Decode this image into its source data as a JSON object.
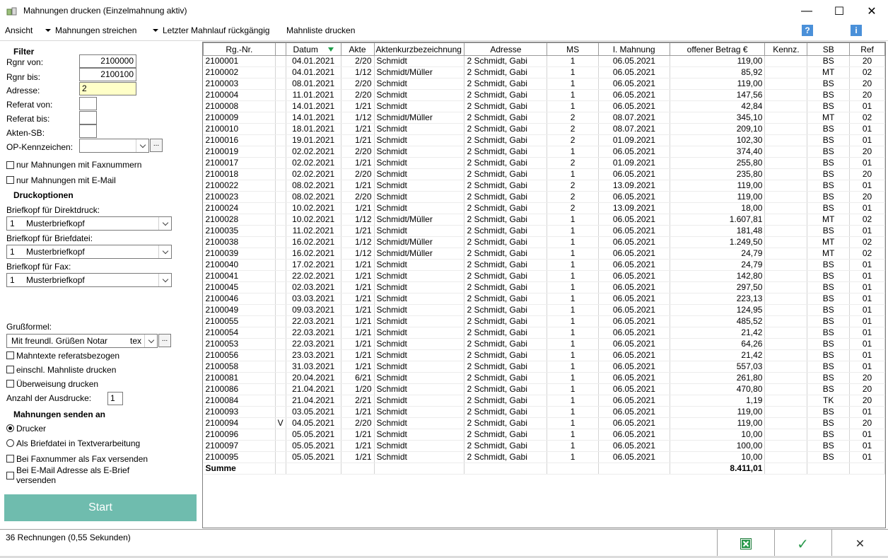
{
  "window": {
    "title": "Mahnungen drucken (Einzelmahnung aktiv)",
    "minimize": "—",
    "maximize": "☐",
    "close": "✕"
  },
  "menu": {
    "ansicht": "Ansicht",
    "streichen": "Mahnungen streichen",
    "rueckgaengig": "Letzter Mahnlauf rückgängig",
    "mahnliste": "Mahnliste drucken",
    "help1": "?",
    "help2": "i"
  },
  "filter": {
    "header": "Filter",
    "rgnr_von_label": "Rgnr von:",
    "rgnr_von_value": "2100000",
    "rgnr_bis_label": "Rgnr bis:",
    "rgnr_bis_value": "2100100",
    "adresse_label": "Adresse:",
    "adresse_value": "2",
    "referat_von_label": "Referat von:",
    "referat_bis_label": "Referat bis:",
    "akten_sb_label": "Akten-SB:",
    "op_kennzeichen_label": "OP-Kennzeichen:",
    "ellipsis": "...",
    "nur_fax": "nur Mahnungen mit Faxnummern",
    "nur_email": "nur Mahnungen mit E-Mail"
  },
  "druck": {
    "header": "Druckoptionen",
    "direktdruck_label": "Briefkopf für Direktdruck:",
    "direktdruck_nr": "1",
    "direktdruck_value": "Musterbriefkopf",
    "briefdatei_label": "Briefkopf für Briefdatei:",
    "briefdatei_nr": "1",
    "briefdatei_value": "Musterbriefkopf",
    "fax_label": "Briefkopf für Fax:",
    "fax_nr": "1",
    "fax_value": "Musterbriefkopf",
    "gruss_label": "Grußformel:",
    "gruss_value": "Mit freundl. Grüßen Notar",
    "gruss_suffix": "tex",
    "mahntexte": "Mahntexte referatsbezogen",
    "einschl": "einschl. Mahnliste drucken",
    "ueberweisung": "Überweisung drucken",
    "anzahl_label": "Anzahl der Ausdrucke:",
    "anzahl_value": "1"
  },
  "senden": {
    "header": "Mahnungen senden an",
    "drucker": "Drucker",
    "briefdatei": "Als Briefdatei in Textverarbeitung",
    "fax": "Bei Faxnummer als Fax versenden",
    "email": "Bei E-Mail Adresse als E-Brief versenden",
    "start": "Start"
  },
  "table": {
    "headers": [
      "Rg.-Nr.",
      "",
      "Datum",
      "Akte",
      "Aktenkurzbezeichnung",
      "Adresse",
      "MS",
      "l. Mahnung",
      "offener Betrag €",
      "Kennz.",
      "SB",
      "Ref"
    ],
    "rows": [
      [
        "2100001",
        "",
        "04.01.2021",
        "2/20",
        "Schmidt",
        "2 Schmidt, Gabi",
        "1",
        "06.05.2021",
        "119,00",
        "",
        "BS",
        "20"
      ],
      [
        "2100002",
        "",
        "04.01.2021",
        "1/12",
        "Schmidt/Müller",
        "2 Schmidt, Gabi",
        "1",
        "06.05.2021",
        "85,92",
        "",
        "MT",
        "02"
      ],
      [
        "2100003",
        "",
        "08.01.2021",
        "2/20",
        "Schmidt",
        "2 Schmidt, Gabi",
        "1",
        "06.05.2021",
        "119,00",
        "",
        "BS",
        "20"
      ],
      [
        "2100004",
        "",
        "11.01.2021",
        "2/20",
        "Schmidt",
        "2 Schmidt, Gabi",
        "1",
        "06.05.2021",
        "147,56",
        "",
        "BS",
        "20"
      ],
      [
        "2100008",
        "",
        "14.01.2021",
        "1/21",
        "Schmidt",
        "2 Schmidt, Gabi",
        "1",
        "06.05.2021",
        "42,84",
        "",
        "BS",
        "01"
      ],
      [
        "2100009",
        "",
        "14.01.2021",
        "1/12",
        "Schmidt/Müller",
        "2 Schmidt, Gabi",
        "2",
        "08.07.2021",
        "345,10",
        "",
        "MT",
        "02"
      ],
      [
        "2100010",
        "",
        "18.01.2021",
        "1/21",
        "Schmidt",
        "2 Schmidt, Gabi",
        "2",
        "08.07.2021",
        "209,10",
        "",
        "BS",
        "01"
      ],
      [
        "2100016",
        "",
        "19.01.2021",
        "1/21",
        "Schmidt",
        "2 Schmidt, Gabi",
        "2",
        "01.09.2021",
        "102,30",
        "",
        "BS",
        "01"
      ],
      [
        "2100019",
        "",
        "02.02.2021",
        "2/20",
        "Schmidt",
        "2 Schmidt, Gabi",
        "1",
        "06.05.2021",
        "374,40",
        "",
        "BS",
        "20"
      ],
      [
        "2100017",
        "",
        "02.02.2021",
        "1/21",
        "Schmidt",
        "2 Schmidt, Gabi",
        "2",
        "01.09.2021",
        "255,80",
        "",
        "BS",
        "01"
      ],
      [
        "2100018",
        "",
        "02.02.2021",
        "2/20",
        "Schmidt",
        "2 Schmidt, Gabi",
        "1",
        "06.05.2021",
        "235,80",
        "",
        "BS",
        "20"
      ],
      [
        "2100022",
        "",
        "08.02.2021",
        "1/21",
        "Schmidt",
        "2 Schmidt, Gabi",
        "2",
        "13.09.2021",
        "119,00",
        "",
        "BS",
        "01"
      ],
      [
        "2100023",
        "",
        "08.02.2021",
        "2/20",
        "Schmidt",
        "2 Schmidt, Gabi",
        "2",
        "06.05.2021",
        "119,00",
        "",
        "BS",
        "20"
      ],
      [
        "2100024",
        "",
        "10.02.2021",
        "1/21",
        "Schmidt",
        "2 Schmidt, Gabi",
        "2",
        "13.09.2021",
        "18,00",
        "",
        "BS",
        "01"
      ],
      [
        "2100028",
        "",
        "10.02.2021",
        "1/12",
        "Schmidt/Müller",
        "2 Schmidt, Gabi",
        "1",
        "06.05.2021",
        "1.607,81",
        "",
        "MT",
        "02"
      ],
      [
        "2100035",
        "",
        "11.02.2021",
        "1/21",
        "Schmidt",
        "2 Schmidt, Gabi",
        "1",
        "06.05.2021",
        "181,48",
        "",
        "BS",
        "01"
      ],
      [
        "2100038",
        "",
        "16.02.2021",
        "1/12",
        "Schmidt/Müller",
        "2 Schmidt, Gabi",
        "1",
        "06.05.2021",
        "1.249,50",
        "",
        "MT",
        "02"
      ],
      [
        "2100039",
        "",
        "16.02.2021",
        "1/12",
        "Schmidt/Müller",
        "2 Schmidt, Gabi",
        "1",
        "06.05.2021",
        "24,79",
        "",
        "MT",
        "02"
      ],
      [
        "2100040",
        "",
        "17.02.2021",
        "1/21",
        "Schmidt",
        "2 Schmidt, Gabi",
        "1",
        "06.05.2021",
        "24,79",
        "",
        "BS",
        "01"
      ],
      [
        "2100041",
        "",
        "22.02.2021",
        "1/21",
        "Schmidt",
        "2 Schmidt, Gabi",
        "1",
        "06.05.2021",
        "142,80",
        "",
        "BS",
        "01"
      ],
      [
        "2100045",
        "",
        "02.03.2021",
        "1/21",
        "Schmidt",
        "2 Schmidt, Gabi",
        "1",
        "06.05.2021",
        "297,50",
        "",
        "BS",
        "01"
      ],
      [
        "2100046",
        "",
        "03.03.2021",
        "1/21",
        "Schmidt",
        "2 Schmidt, Gabi",
        "1",
        "06.05.2021",
        "223,13",
        "",
        "BS",
        "01"
      ],
      [
        "2100049",
        "",
        "09.03.2021",
        "1/21",
        "Schmidt",
        "2 Schmidt, Gabi",
        "1",
        "06.05.2021",
        "124,95",
        "",
        "BS",
        "01"
      ],
      [
        "2100055",
        "",
        "22.03.2021",
        "1/21",
        "Schmidt",
        "2 Schmidt, Gabi",
        "1",
        "06.05.2021",
        "485,52",
        "",
        "BS",
        "01"
      ],
      [
        "2100054",
        "",
        "22.03.2021",
        "1/21",
        "Schmidt",
        "2 Schmidt, Gabi",
        "1",
        "06.05.2021",
        "21,42",
        "",
        "BS",
        "01"
      ],
      [
        "2100053",
        "",
        "22.03.2021",
        "1/21",
        "Schmidt",
        "2 Schmidt, Gabi",
        "1",
        "06.05.2021",
        "64,26",
        "",
        "BS",
        "01"
      ],
      [
        "2100056",
        "",
        "23.03.2021",
        "1/21",
        "Schmidt",
        "2 Schmidt, Gabi",
        "1",
        "06.05.2021",
        "21,42",
        "",
        "BS",
        "01"
      ],
      [
        "2100058",
        "",
        "31.03.2021",
        "1/21",
        "Schmidt",
        "2 Schmidt, Gabi",
        "1",
        "06.05.2021",
        "557,03",
        "",
        "BS",
        "01"
      ],
      [
        "2100081",
        "",
        "20.04.2021",
        "6/21",
        "Schmidt",
        "2 Schmidt, Gabi",
        "1",
        "06.05.2021",
        "261,80",
        "",
        "BS",
        "20"
      ],
      [
        "2100086",
        "",
        "21.04.2021",
        "1/20",
        "Schmidt",
        "2 Schmidt, Gabi",
        "1",
        "06.05.2021",
        "470,80",
        "",
        "BS",
        "20"
      ],
      [
        "2100084",
        "",
        "21.04.2021",
        "2/21",
        "Schmidt",
        "2 Schmidt, Gabi",
        "1",
        "06.05.2021",
        "1,19",
        "",
        "TK",
        "20"
      ],
      [
        "2100093",
        "",
        "03.05.2021",
        "1/21",
        "Schmidt",
        "2 Schmidt, Gabi",
        "1",
        "06.05.2021",
        "119,00",
        "",
        "BS",
        "01"
      ],
      [
        "2100094",
        "V",
        "04.05.2021",
        "2/20",
        "Schmidt",
        "2 Schmidt, Gabi",
        "1",
        "06.05.2021",
        "119,00",
        "",
        "BS",
        "20"
      ],
      [
        "2100096",
        "",
        "05.05.2021",
        "1/21",
        "Schmidt",
        "2 Schmidt, Gabi",
        "1",
        "06.05.2021",
        "10,00",
        "",
        "BS",
        "01"
      ],
      [
        "2100097",
        "",
        "05.05.2021",
        "1/21",
        "Schmidt",
        "2 Schmidt, Gabi",
        "1",
        "06.05.2021",
        "100,00",
        "",
        "BS",
        "01"
      ],
      [
        "2100095",
        "",
        "05.05.2021",
        "1/21",
        "Schmidt",
        "2 Schmidt, Gabi",
        "1",
        "06.05.2021",
        "10,00",
        "",
        "BS",
        "01"
      ]
    ],
    "sum_label": "Summe",
    "sum_value": "8.411,01"
  },
  "status": {
    "text": "36 Rechnungen (0,55 Sekunden)",
    "excel_label": "X",
    "ok_label": "✓",
    "cancel_label": "✕"
  },
  "colors": {
    "accent_start": "#6fbcae",
    "highlight_field": "#ffffc8",
    "help_icon": "#4a90d9",
    "sort_arrow": "#1f9e4a"
  }
}
